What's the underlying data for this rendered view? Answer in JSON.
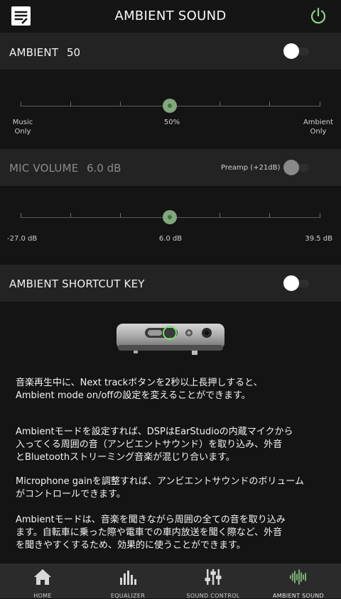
{
  "header": {
    "title": "AMBIENT SOUND",
    "logo_icon": "earstudio-logo-icon",
    "power_icon": "power-icon",
    "accent_color": "#8fd08a"
  },
  "ambient": {
    "label": "AMBIENT",
    "value": "50",
    "toggle_on": false,
    "slider": {
      "left_label_1": "Music",
      "left_label_2": "Only",
      "center_label": "50%",
      "right_label_1": "Ambient",
      "right_label_2": "Only",
      "level_percent": 50
    }
  },
  "mic": {
    "label": "MIC VOLUME",
    "value": "6.0 dB",
    "preamp_label": "Preamp (+21dB)",
    "preamp_on": false,
    "slider": {
      "min_label": "-27.0 dB",
      "center_label": "6.0 dB",
      "max_label": "39.5 dB",
      "level_percent": 49.6
    }
  },
  "shortcut": {
    "label": "AMBIENT SHORTCUT KEY",
    "toggle_on": false
  },
  "description": {
    "p1_line1": "音楽再生中に、Next trackボタンを2秒以上長押しすると、",
    "p1_line2": "Ambient mode on/offの設定を変えることができます。",
    "p2_line1": "Ambientモードを設定すれば、DSPはEarStudioの内蔵マイクから",
    "p2_line2": "入ってくる周囲の音（アンビエントサウンド）を取り込み、外音",
    "p2_line3": "とBluetoothストリーミング音楽が混じり合います。",
    "p3_line1": "Microphone gainを調整すれば、アンビエントサウンドのボリューム",
    "p3_line2": "がコントロールできます。",
    "p4_line1": "Ambientモードは、音楽を聞きながら周囲の全ての音を取り込み",
    "p4_line2": "ます。自転車に乗った際や電車での車内放送を聞く際など、外音",
    "p4_line3": "を聞きやすくするため、効果的に使うことができます。"
  },
  "tabs": [
    {
      "label": "HOME",
      "icon": "home-icon"
    },
    {
      "label": "EQUALIZER",
      "icon": "equalizer-icon"
    },
    {
      "label": "SOUND CONTROL",
      "icon": "sliders-icon"
    },
    {
      "label": "AMBIENT SOUND",
      "icon": "soundwave-icon",
      "active": true
    }
  ]
}
